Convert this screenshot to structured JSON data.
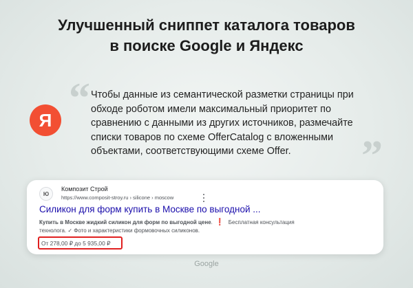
{
  "heading": {
    "line1": "Улучшенный сниппет каталога товаров",
    "line2": "в поиске Google и Яндекс"
  },
  "quote": {
    "open_mark": "“",
    "close_mark": "”",
    "lines": [
      "Чтобы данные из семантической разметки страницы при",
      "обходе роботом имели максимальный приоритет по",
      "сравнению с данными из других источников, размечайте",
      "списки товаров по схеме OfferCatalog с вложенными",
      "объектами, соответствующими схеме Offer."
    ]
  },
  "yandex_logo": {
    "letter": "Я",
    "color": "#f24f33"
  },
  "snippet": {
    "favicon_text": "Ю",
    "site_name": "Композит Строй",
    "url": "https://www.composit-stroy.ru › silicone › moscow",
    "title": "Силикон для форм купить в Москве по выгодной ...",
    "desc_bold": "Купить в Москве жидкий силикон для форм по выгодной цене",
    "desc_rest1": ". ",
    "desc_excl": "❗",
    "desc_rest2": " Бесплатная консультация",
    "desc_line2": "технолога. ✓ Фото и характеристики формовочных силиконов.",
    "price_range": "От 278,00 ₽ до 5 935,00 ₽"
  },
  "caption": "Google",
  "colors": {
    "link": "#1a0dab",
    "highlight_border": "#e01f1f",
    "quote_marks": "#c8d0ce"
  }
}
